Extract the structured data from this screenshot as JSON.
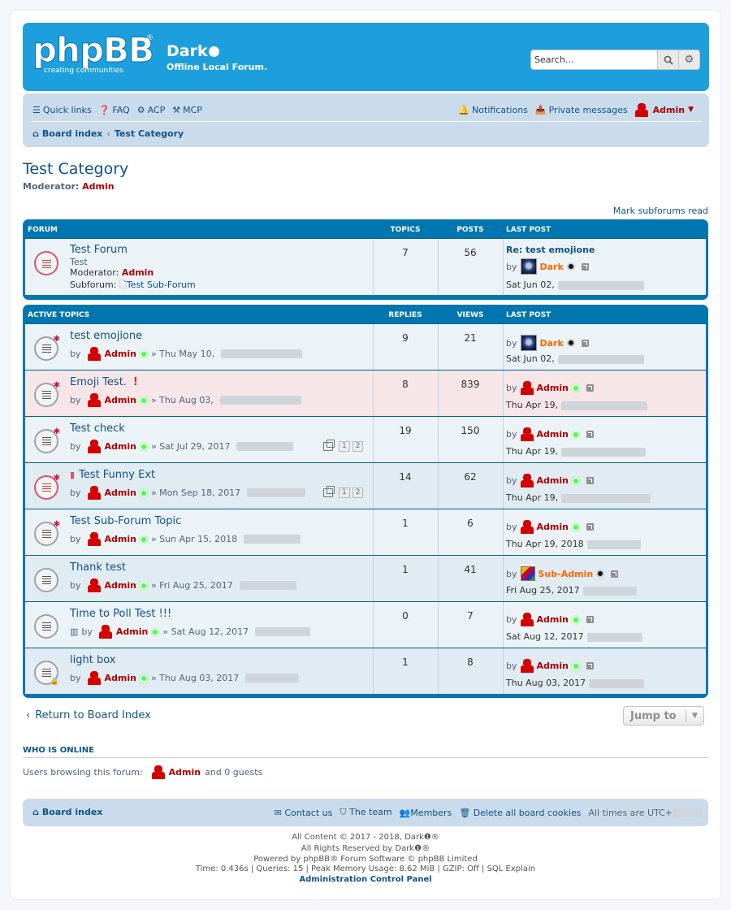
{
  "header": {
    "logo_text": "phpBB",
    "logo_reg": "®",
    "logo_tag": "creating     communities",
    "site_name": "Dark",
    "site_desc": "Offline Local Forum.",
    "search_placeholder": "Search…"
  },
  "nav": {
    "quick_links": "Quick links",
    "faq": "FAQ",
    "acp": "ACP",
    "mcp": "MCP",
    "notifications": "Notifications",
    "private_messages": "Private messages",
    "user": "Admin"
  },
  "breadcrumb": {
    "home": "Board index",
    "category": "Test Category"
  },
  "page": {
    "title": "Test Category",
    "moderator_label": "Moderator:",
    "moderator": "Admin",
    "mark_read": "Mark subforums read"
  },
  "forums": {
    "headers": {
      "forum": "Forum",
      "topics": "Topics",
      "posts": "Posts",
      "last_post": "Last post"
    },
    "rows": [
      {
        "title": "Test Forum",
        "desc": "Test",
        "mod_label": "Moderator:",
        "mod": "Admin",
        "sub_label": "Subforum:",
        "sub": "Test Sub-Forum",
        "topics": "7",
        "posts": "56",
        "lp_title": "Re: test emojione",
        "lp_by": "by",
        "lp_user": "Dark",
        "lp_date": "Sat Jun 02,"
      }
    ]
  },
  "topics": {
    "headers": {
      "title": "Active topics",
      "replies": "Replies",
      "views": "Views",
      "last_post": "Last post"
    },
    "rows": [
      {
        "title": "test emojione",
        "by": "by",
        "author": "Admin",
        "date": "» Thu May 10,",
        "replies": "9",
        "views": "21",
        "lp_user": "Dark",
        "lp_date": "Sat Jun 02,"
      },
      {
        "title": "Emoji Test.",
        "by": "by",
        "author": "Admin",
        "date": "» Thu Aug 03,",
        "replies": "8",
        "views": "839",
        "lp_user": "Admin",
        "lp_date": "Thu Apr 19,"
      },
      {
        "title": "Test check",
        "by": "by",
        "author": "Admin",
        "date": "» Sat Jul 29, 2017",
        "replies": "19",
        "views": "150",
        "lp_user": "Admin",
        "lp_date": "Thu Apr 19,",
        "pages": [
          "1",
          "2"
        ]
      },
      {
        "title": "Test Funny Ext",
        "by": "by",
        "author": "Admin",
        "date": "» Mon Sep 18, 2017",
        "replies": "14",
        "views": "62",
        "lp_user": "Admin",
        "lp_date": "Thu Apr 19,",
        "pages": [
          "1",
          "2"
        ]
      },
      {
        "title": "Test Sub-Forum Topic",
        "by": "by",
        "author": "Admin",
        "date": "» Sun Apr 15, 2018",
        "replies": "1",
        "views": "6",
        "lp_user": "Admin",
        "lp_date": "Thu Apr 19, 2018"
      },
      {
        "title": "Thank test",
        "by": "by",
        "author": "Admin",
        "date": "» Fri Aug 25, 2017",
        "replies": "1",
        "views": "41",
        "lp_user": "Sub-Admin",
        "lp_date": "Fri Aug 25, 2017"
      },
      {
        "title": "Time to Poll Test !!!",
        "by": "by",
        "author": "Admin",
        "date": "» Sat Aug 12, 2017",
        "replies": "0",
        "views": "7",
        "lp_user": "Admin",
        "lp_date": "Sat Aug 12, 2017"
      },
      {
        "title": "light box",
        "by": "by",
        "author": "Admin",
        "date": "» Thu Aug 03, 2017",
        "replies": "1",
        "views": "8",
        "lp_user": "Admin",
        "lp_date": "Thu Aug 03, 2017"
      }
    ]
  },
  "bottom": {
    "return": "Return to Board Index",
    "jump": "Jump to",
    "who_online": "Who is online",
    "browsing_label": "Users browsing this forum:",
    "browsing_user": "Admin",
    "browsing_rest": "and 0 guests"
  },
  "footer": {
    "board_index": "Board index",
    "contact": "Contact us",
    "team": "The team",
    "members": "Members",
    "delete_cookies": "Delete all board cookies",
    "timezone": "All times are UTC+",
    "line1": "All Content © 2017 - 2018, Dark❶®",
    "line2": "All Rights Reserved by Dark❶®",
    "line3": "Powered by phpBB® Forum Software © phpBB Limited",
    "line4": "Time: 0.436s | Queries: 15 | Peak Memory Usage: 8.62 MiB | GZIP: Off | SQL Explain",
    "line5": "Administration Control Panel"
  },
  "colors": {
    "header": "#1d9fde",
    "nav": "#cadceb",
    "table": "#0076b1",
    "admin": "#AA0000",
    "sub_admin": "#FF6600",
    "dark": "#FF6600"
  }
}
